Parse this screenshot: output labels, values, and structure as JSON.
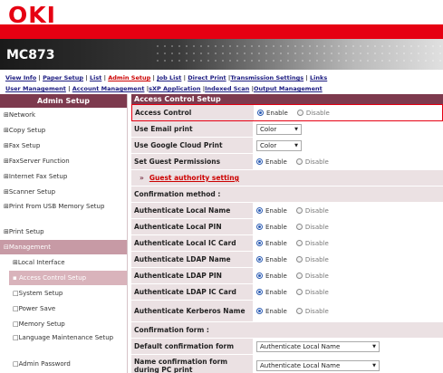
{
  "brand": {
    "logo": "OKI",
    "model": "MC873"
  },
  "nav": {
    "row1": [
      "View Info",
      "Paper Setup",
      "List",
      "Admin Setup",
      "Job List",
      "Direct Print",
      "Transmission Settings",
      "Links"
    ],
    "row2": [
      "User Management",
      "Account Management",
      "sXP Application",
      "Indexed Scan",
      "Output Management"
    ],
    "active": "Admin Setup"
  },
  "sidebar": {
    "title": "Admin Setup",
    "items": [
      {
        "label": "⊞Network"
      },
      {
        "label": "⊞Copy Setup"
      },
      {
        "label": "⊞Fax Setup"
      },
      {
        "label": "⊞FaxServer Function"
      },
      {
        "label": "⊞Internet Fax Setup"
      },
      {
        "label": "⊞Scanner Setup"
      },
      {
        "label": "⊞Print From USB Memory Setup"
      },
      {
        "label": "⊞Print Setup"
      },
      {
        "label": "⊟Management"
      },
      {
        "label": "⊞Local Interface"
      },
      {
        "label": "Access Control Setup"
      },
      {
        "label": "System Setup"
      },
      {
        "label": "Power Save"
      },
      {
        "label": "Memory Setup"
      },
      {
        "label": "Language Maintenance Setup"
      },
      {
        "label": "Admin Password"
      }
    ]
  },
  "content": {
    "header": "Access Control Setup",
    "radio_labels": {
      "enable": "Enable",
      "disable": "Disable"
    },
    "rows": {
      "access_control": "Access Control",
      "use_email_print": "Use Email print",
      "email_print_value": "Color",
      "use_cloud_print": "Use Google Cloud Print",
      "cloud_print_value": "Color",
      "guest_permissions": "Set Guest Permissions",
      "guest_authority": "Guest authority setting",
      "confirmation_method": "Confirmation method :",
      "auth_local_name": "Authenticate Local Name",
      "auth_local_pin": "Authenticate Local PIN",
      "auth_local_ic": "Authenticate Local IC Card",
      "auth_ldap_name": "Authenticate LDAP Name",
      "auth_ldap_pin": "Authenticate LDAP PIN",
      "auth_ldap_ic": "Authenticate LDAP IC Card",
      "auth_kerberos": "Authenticate Kerberos Name",
      "confirmation_form": "Confirmation form :",
      "default_form": "Default confirmation form",
      "default_form_value": "Authenticate Local Name",
      "name_form_pc": "Name confirmation form during PC print",
      "name_form_pc_value": "Authenticate Local Name"
    }
  }
}
